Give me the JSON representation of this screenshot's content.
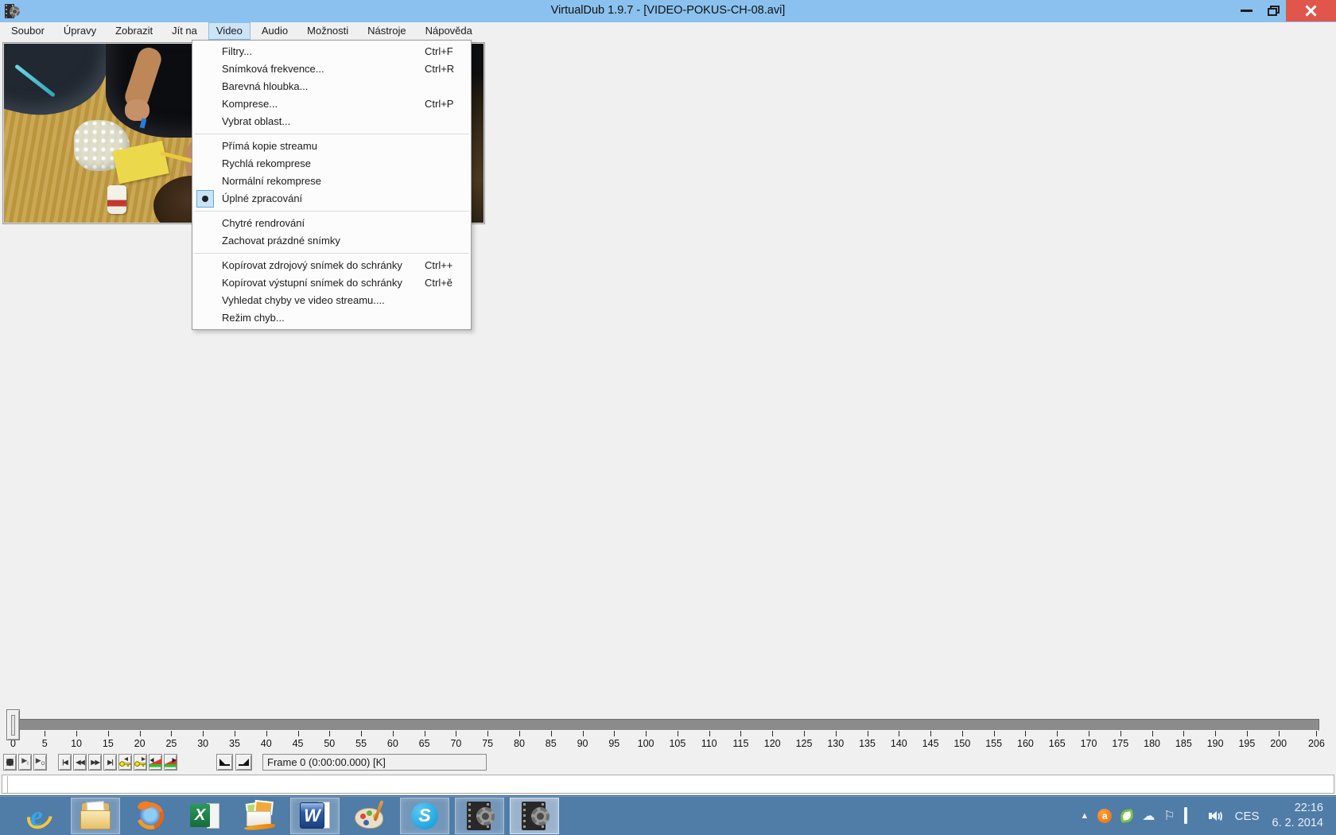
{
  "window": {
    "title": "VirtualDub 1.9.7 - [VIDEO-POKUS-CH-08.avi]"
  },
  "menu_bar": {
    "items": [
      {
        "slug": "soubor",
        "label": "Soubor"
      },
      {
        "slug": "upravy",
        "label": "Úpravy"
      },
      {
        "slug": "zobrazit",
        "label": "Zobrazit"
      },
      {
        "slug": "jit-na",
        "label": "Jít na"
      },
      {
        "slug": "video",
        "label": "Video",
        "selected": true
      },
      {
        "slug": "audio",
        "label": "Audio"
      },
      {
        "slug": "moznosti",
        "label": "Možnosti"
      },
      {
        "slug": "nastroje",
        "label": "Nástroje"
      },
      {
        "slug": "napoveda",
        "label": "Nápověda"
      }
    ]
  },
  "video_menu": {
    "items": [
      {
        "slug": "filters",
        "label": "Filtry...",
        "shortcut": "Ctrl+F"
      },
      {
        "slug": "frame-rate",
        "label": "Snímková frekvence...",
        "shortcut": "Ctrl+R"
      },
      {
        "slug": "color-depth",
        "label": "Barevná hloubka..."
      },
      {
        "slug": "compression",
        "label": "Komprese...",
        "shortcut": "Ctrl+P"
      },
      {
        "slug": "select-range",
        "label": "Vybrat oblast..."
      },
      {
        "slug": "direct-stream-copy",
        "label": "Přímá kopie streamu",
        "sep_before": true
      },
      {
        "slug": "fast-recompress",
        "label": "Rychlá rekomprese"
      },
      {
        "slug": "normal-recompress",
        "label": "Normální rekomprese"
      },
      {
        "slug": "full-processing",
        "label": "Úplné zpracování",
        "radio": true
      },
      {
        "slug": "smart-rendering",
        "label": "Chytré rendrování",
        "sep_before": true
      },
      {
        "slug": "preserve-empty",
        "label": "Zachovat prázdné snímky"
      },
      {
        "slug": "copy-source-frame",
        "label": "Kopírovat zdrojový snímek do schránky",
        "shortcut": "Ctrl++",
        "sep_before": true
      },
      {
        "slug": "copy-output-frame",
        "label": "Kopírovat výstupní snímek do schránky",
        "shortcut": "Ctrl+ě"
      },
      {
        "slug": "scan-for-errors",
        "label": "Vyhledat chyby ve video streamu...."
      },
      {
        "slug": "error-mode",
        "label": "Režim chyb..."
      }
    ]
  },
  "timeline": {
    "tick_labels": [
      0,
      5,
      10,
      15,
      20,
      25,
      30,
      35,
      40,
      45,
      50,
      55,
      60,
      65,
      70,
      75,
      80,
      85,
      90,
      95,
      100,
      105,
      110,
      115,
      120,
      125,
      130,
      135,
      140,
      145,
      150,
      155,
      160,
      165,
      170,
      175,
      180,
      185,
      190,
      195,
      200,
      206
    ],
    "max_frame": 206,
    "position_frame": 0
  },
  "transport": {
    "buttons": [
      {
        "slug": "stop",
        "icon": "stop"
      },
      {
        "slug": "play-input",
        "icon": "play",
        "glyph": "▶",
        "sub": "I"
      },
      {
        "slug": "play-output",
        "icon": "play",
        "glyph": "▶",
        "sub": "O"
      },
      {
        "slug": "go-start",
        "icon": "text",
        "glyph": "|◀"
      },
      {
        "slug": "frame-back",
        "icon": "text",
        "glyph": "◀◀"
      },
      {
        "slug": "frame-forward",
        "icon": "text",
        "glyph": "▶▶"
      },
      {
        "slug": "go-end",
        "icon": "text",
        "glyph": "▶|"
      },
      {
        "slug": "prev-keyframe",
        "icon": "key",
        "dir": "left"
      },
      {
        "slug": "next-keyframe",
        "icon": "key",
        "dir": "right"
      },
      {
        "slug": "prev-scene",
        "icon": "scene",
        "dir": "left"
      },
      {
        "slug": "next-scene",
        "icon": "scene",
        "dir": "right"
      },
      {
        "slug": "mark-in",
        "icon": "mark",
        "dir": "left"
      },
      {
        "slug": "mark-out",
        "icon": "mark",
        "dir": "right"
      }
    ]
  },
  "status": {
    "frame_text": "Frame 0 (0:00:00.000) [K]"
  },
  "taskbar": {
    "apps": [
      {
        "slug": "internet-explorer",
        "icon": "ie",
        "glyph": "e"
      },
      {
        "slug": "file-explorer",
        "icon": "folder",
        "open": true
      },
      {
        "slug": "firefox",
        "icon": "firefox"
      },
      {
        "slug": "excel",
        "icon": "excel",
        "glyph": "X"
      },
      {
        "slug": "mail",
        "icon": "mail"
      },
      {
        "slug": "word",
        "icon": "word",
        "glyph": "W",
        "open": true
      },
      {
        "slug": "paint",
        "icon": "paint"
      },
      {
        "slug": "skype",
        "icon": "skype",
        "glyph": "S",
        "open": true
      },
      {
        "slug": "virtualdub-1",
        "icon": "vdub",
        "open": true
      },
      {
        "slug": "virtualdub-2",
        "icon": "vdub",
        "open": true,
        "active": true
      }
    ],
    "tray": {
      "icons": [
        {
          "slug": "show-hidden-icons",
          "icon": "char",
          "glyph": "▲",
          "small": true
        },
        {
          "slug": "avast",
          "icon": "avast",
          "glyph": "a"
        },
        {
          "slug": "green-shield",
          "icon": "green"
        },
        {
          "slug": "skydrive-cloud",
          "icon": "char",
          "glyph": "☁"
        },
        {
          "slug": "action-center-flag",
          "icon": "char",
          "glyph": "⚐"
        },
        {
          "slug": "network",
          "icon": "network"
        },
        {
          "slug": "volume",
          "icon": "volume"
        }
      ],
      "language": "CES",
      "time": "22:16",
      "date": "6. 2. 2014"
    }
  },
  "colors": {
    "titlebar": "#8BC1EE",
    "close_button": "#E0564A",
    "menu_selection_fill": "#CDE4F7",
    "menu_selection_border": "#8FBEE4",
    "radio_check_fill": "#C7E4F7",
    "taskbar": "#507CA8",
    "track_gray": "#8B8B8B",
    "client_background": "#F0F0F0"
  }
}
